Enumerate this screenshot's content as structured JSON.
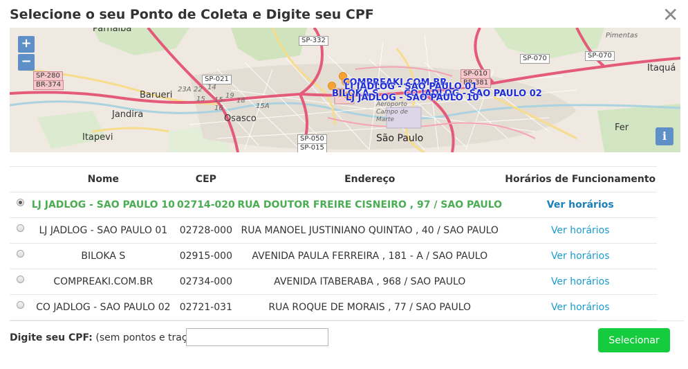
{
  "dialog": {
    "title": "Selecione o seu Ponto de Coleta e Digite seu CPF",
    "close_glyph": "✕"
  },
  "map": {
    "zoom_in": "+",
    "zoom_out": "−",
    "info": "i",
    "places": [
      "Parnaíba",
      "Barueri",
      "Jandira",
      "Itapevi",
      "Osasco",
      "São Paulo",
      "Fer",
      "Itaquá",
      "Pimentas",
      "Aeroporto Campo de Marte"
    ],
    "roads": [
      "SP-332",
      "SP-280",
      "BR-374",
      "SP-021",
      "SP-010",
      "BR-381",
      "SP-070",
      "SP-070",
      "SP-050",
      "SP-015"
    ],
    "road_numbers": [
      "23A",
      "22",
      "14",
      "19",
      "18",
      "15A",
      "15",
      "16",
      "15"
    ],
    "markers": [
      "COMPREAKI.COM.BR",
      "LJ JADLOG - SAO PAULO 01",
      "BILOKA S",
      "CO JADLOG - SAO PAULO 02",
      "LJ JADLOG - SAO PAULO 10"
    ]
  },
  "table": {
    "headers": {
      "name": "Nome",
      "cep": "CEP",
      "address": "Endereço",
      "hours": "Horários de Funcionamento"
    },
    "rows": [
      {
        "name": "LJ JADLOG - SAO PAULO 10",
        "cep": "02714-020",
        "address": "RUA DOUTOR FREIRE CISNEIRO , 97 / SAO PAULO",
        "hours_link": "Ver horários"
      },
      {
        "name": "LJ JADLOG - SAO PAULO 01",
        "cep": "02728-000",
        "address": "RUA MANOEL JUSTINIANO QUINTAO , 40 / SAO PAULO",
        "hours_link": "Ver horários"
      },
      {
        "name": "BILOKA S",
        "cep": "02915-000",
        "address": "AVENIDA PAULA FERREIRA , 181 - A / SAO PAULO",
        "hours_link": "Ver horários"
      },
      {
        "name": "COMPREAKI.COM.BR",
        "cep": "02734-000",
        "address": "AVENIDA ITABERABA , 968 / SAO PAULO",
        "hours_link": "Ver horários"
      },
      {
        "name": "CO JADLOG - SAO PAULO 02",
        "cep": "02721-031",
        "address": "RUA ROQUE DE MORAIS , 77 / SAO PAULO",
        "hours_link": "Ver horários"
      }
    ]
  },
  "cpf": {
    "label": "Digite seu CPF:",
    "hint": "(sem pontos e traços)",
    "value": "",
    "placeholder": ""
  },
  "actions": {
    "select_label": "Selecionar"
  },
  "colors": {
    "selected_row": "#4aad52",
    "link": "#1a9bd0",
    "button": "#14cc3d",
    "marker": "#f5a236",
    "marker_label": "#1f2dd6"
  }
}
